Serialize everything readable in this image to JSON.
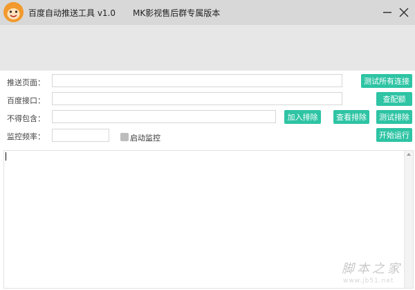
{
  "window": {
    "title": "百度自动推送工具 v1.0",
    "subtitle": "MK影视售后群专属版本",
    "minimize_icon": "minimize-icon",
    "close_icon": "close-icon",
    "app_icon": "monkey-face-icon"
  },
  "form": {
    "push_page": {
      "label": "推送页面：",
      "value": ""
    },
    "baidu_api": {
      "label": "百度接口：",
      "value": ""
    },
    "exclude": {
      "label": "不得包含：",
      "value": ""
    },
    "frequency": {
      "label": "监控频率：",
      "value": ""
    },
    "monitor_checkbox": {
      "label": "启动监控",
      "checked": false
    }
  },
  "buttons": {
    "test_all": "测试所有连接",
    "check_quota": "查配额",
    "add_exclude": "加入排除",
    "view_exclude": "查看排除",
    "test_exclude": "测试排除",
    "start": "开始运行"
  },
  "log": {
    "content": ""
  },
  "watermark": {
    "main": "脚本之家",
    "url": "www.jb51.net"
  },
  "colors": {
    "accent": "#2ec4a4",
    "titlebar": "#d8d8d8",
    "banner": "#e7e7e7",
    "app_icon": "#f29a2e"
  }
}
